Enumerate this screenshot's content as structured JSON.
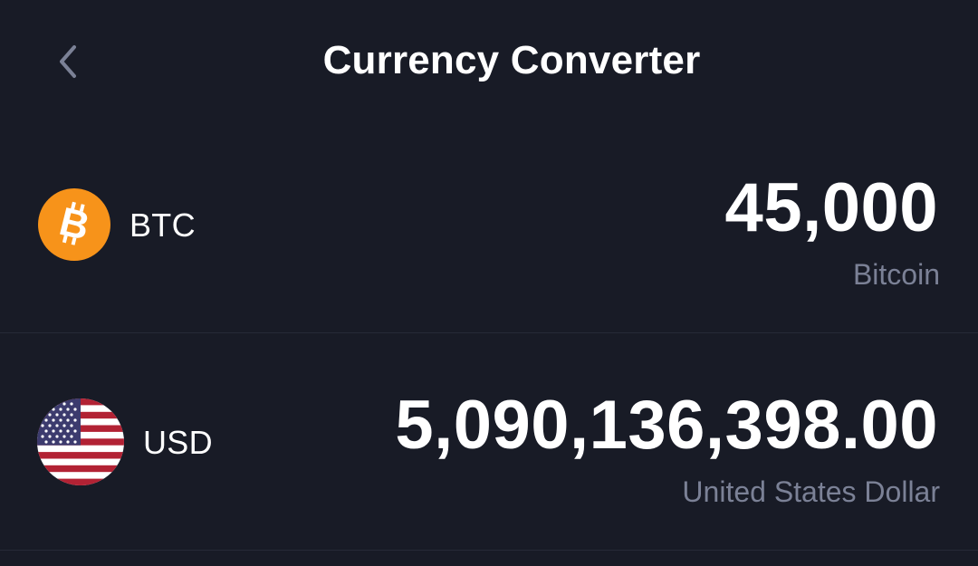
{
  "header": {
    "title": "Currency Converter",
    "back_icon": "chevron-left-icon"
  },
  "colors": {
    "background": "#181b26",
    "divider": "#262a37",
    "secondary_text": "#7b8196",
    "bitcoin_orange": "#f7931a",
    "flag_red": "#b22234",
    "flag_blue": "#3c3b6e"
  },
  "rows": [
    {
      "code": "BTC",
      "amount": "45,000",
      "name": "Bitcoin",
      "icon": "bitcoin-icon"
    },
    {
      "code": "USD",
      "amount": "5,090,136,398.00",
      "name": "United States Dollar",
      "icon": "us-flag-icon"
    }
  ]
}
